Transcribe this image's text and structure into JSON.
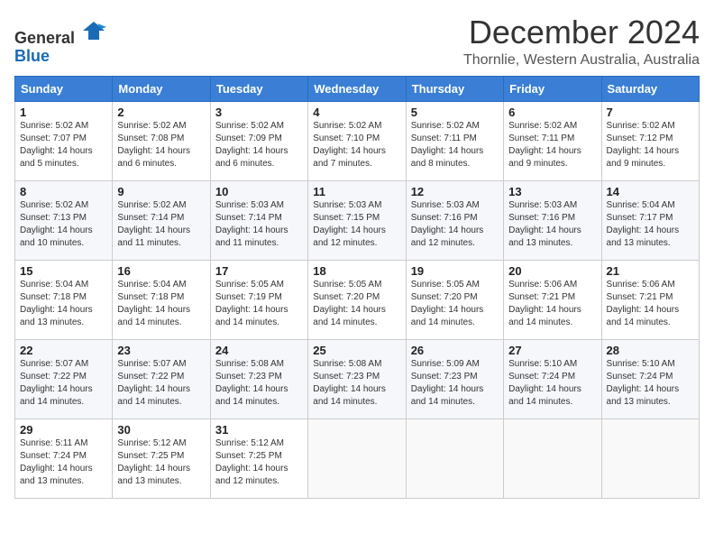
{
  "logo": {
    "general": "General",
    "blue": "Blue"
  },
  "title": "December 2024",
  "location": "Thornlie, Western Australia, Australia",
  "days_of_week": [
    "Sunday",
    "Monday",
    "Tuesday",
    "Wednesday",
    "Thursday",
    "Friday",
    "Saturday"
  ],
  "weeks": [
    [
      {
        "day": "1",
        "sunrise": "5:02 AM",
        "sunset": "7:07 PM",
        "daylight": "14 hours and 5 minutes."
      },
      {
        "day": "2",
        "sunrise": "5:02 AM",
        "sunset": "7:08 PM",
        "daylight": "14 hours and 6 minutes."
      },
      {
        "day": "3",
        "sunrise": "5:02 AM",
        "sunset": "7:09 PM",
        "daylight": "14 hours and 6 minutes."
      },
      {
        "day": "4",
        "sunrise": "5:02 AM",
        "sunset": "7:10 PM",
        "daylight": "14 hours and 7 minutes."
      },
      {
        "day": "5",
        "sunrise": "5:02 AM",
        "sunset": "7:11 PM",
        "daylight": "14 hours and 8 minutes."
      },
      {
        "day": "6",
        "sunrise": "5:02 AM",
        "sunset": "7:11 PM",
        "daylight": "14 hours and 9 minutes."
      },
      {
        "day": "7",
        "sunrise": "5:02 AM",
        "sunset": "7:12 PM",
        "daylight": "14 hours and 9 minutes."
      }
    ],
    [
      {
        "day": "8",
        "sunrise": "5:02 AM",
        "sunset": "7:13 PM",
        "daylight": "14 hours and 10 minutes."
      },
      {
        "day": "9",
        "sunrise": "5:02 AM",
        "sunset": "7:14 PM",
        "daylight": "14 hours and 11 minutes."
      },
      {
        "day": "10",
        "sunrise": "5:03 AM",
        "sunset": "7:14 PM",
        "daylight": "14 hours and 11 minutes."
      },
      {
        "day": "11",
        "sunrise": "5:03 AM",
        "sunset": "7:15 PM",
        "daylight": "14 hours and 12 minutes."
      },
      {
        "day": "12",
        "sunrise": "5:03 AM",
        "sunset": "7:16 PM",
        "daylight": "14 hours and 12 minutes."
      },
      {
        "day": "13",
        "sunrise": "5:03 AM",
        "sunset": "7:16 PM",
        "daylight": "14 hours and 13 minutes."
      },
      {
        "day": "14",
        "sunrise": "5:04 AM",
        "sunset": "7:17 PM",
        "daylight": "14 hours and 13 minutes."
      }
    ],
    [
      {
        "day": "15",
        "sunrise": "5:04 AM",
        "sunset": "7:18 PM",
        "daylight": "14 hours and 13 minutes."
      },
      {
        "day": "16",
        "sunrise": "5:04 AM",
        "sunset": "7:18 PM",
        "daylight": "14 hours and 14 minutes."
      },
      {
        "day": "17",
        "sunrise": "5:05 AM",
        "sunset": "7:19 PM",
        "daylight": "14 hours and 14 minutes."
      },
      {
        "day": "18",
        "sunrise": "5:05 AM",
        "sunset": "7:20 PM",
        "daylight": "14 hours and 14 minutes."
      },
      {
        "day": "19",
        "sunrise": "5:05 AM",
        "sunset": "7:20 PM",
        "daylight": "14 hours and 14 minutes."
      },
      {
        "day": "20",
        "sunrise": "5:06 AM",
        "sunset": "7:21 PM",
        "daylight": "14 hours and 14 minutes."
      },
      {
        "day": "21",
        "sunrise": "5:06 AM",
        "sunset": "7:21 PM",
        "daylight": "14 hours and 14 minutes."
      }
    ],
    [
      {
        "day": "22",
        "sunrise": "5:07 AM",
        "sunset": "7:22 PM",
        "daylight": "14 hours and 14 minutes."
      },
      {
        "day": "23",
        "sunrise": "5:07 AM",
        "sunset": "7:22 PM",
        "daylight": "14 hours and 14 minutes."
      },
      {
        "day": "24",
        "sunrise": "5:08 AM",
        "sunset": "7:23 PM",
        "daylight": "14 hours and 14 minutes."
      },
      {
        "day": "25",
        "sunrise": "5:08 AM",
        "sunset": "7:23 PM",
        "daylight": "14 hours and 14 minutes."
      },
      {
        "day": "26",
        "sunrise": "5:09 AM",
        "sunset": "7:23 PM",
        "daylight": "14 hours and 14 minutes."
      },
      {
        "day": "27",
        "sunrise": "5:10 AM",
        "sunset": "7:24 PM",
        "daylight": "14 hours and 14 minutes."
      },
      {
        "day": "28",
        "sunrise": "5:10 AM",
        "sunset": "7:24 PM",
        "daylight": "14 hours and 13 minutes."
      }
    ],
    [
      {
        "day": "29",
        "sunrise": "5:11 AM",
        "sunset": "7:24 PM",
        "daylight": "14 hours and 13 minutes."
      },
      {
        "day": "30",
        "sunrise": "5:12 AM",
        "sunset": "7:25 PM",
        "daylight": "14 hours and 13 minutes."
      },
      {
        "day": "31",
        "sunrise": "5:12 AM",
        "sunset": "7:25 PM",
        "daylight": "14 hours and 12 minutes."
      },
      null,
      null,
      null,
      null
    ]
  ]
}
